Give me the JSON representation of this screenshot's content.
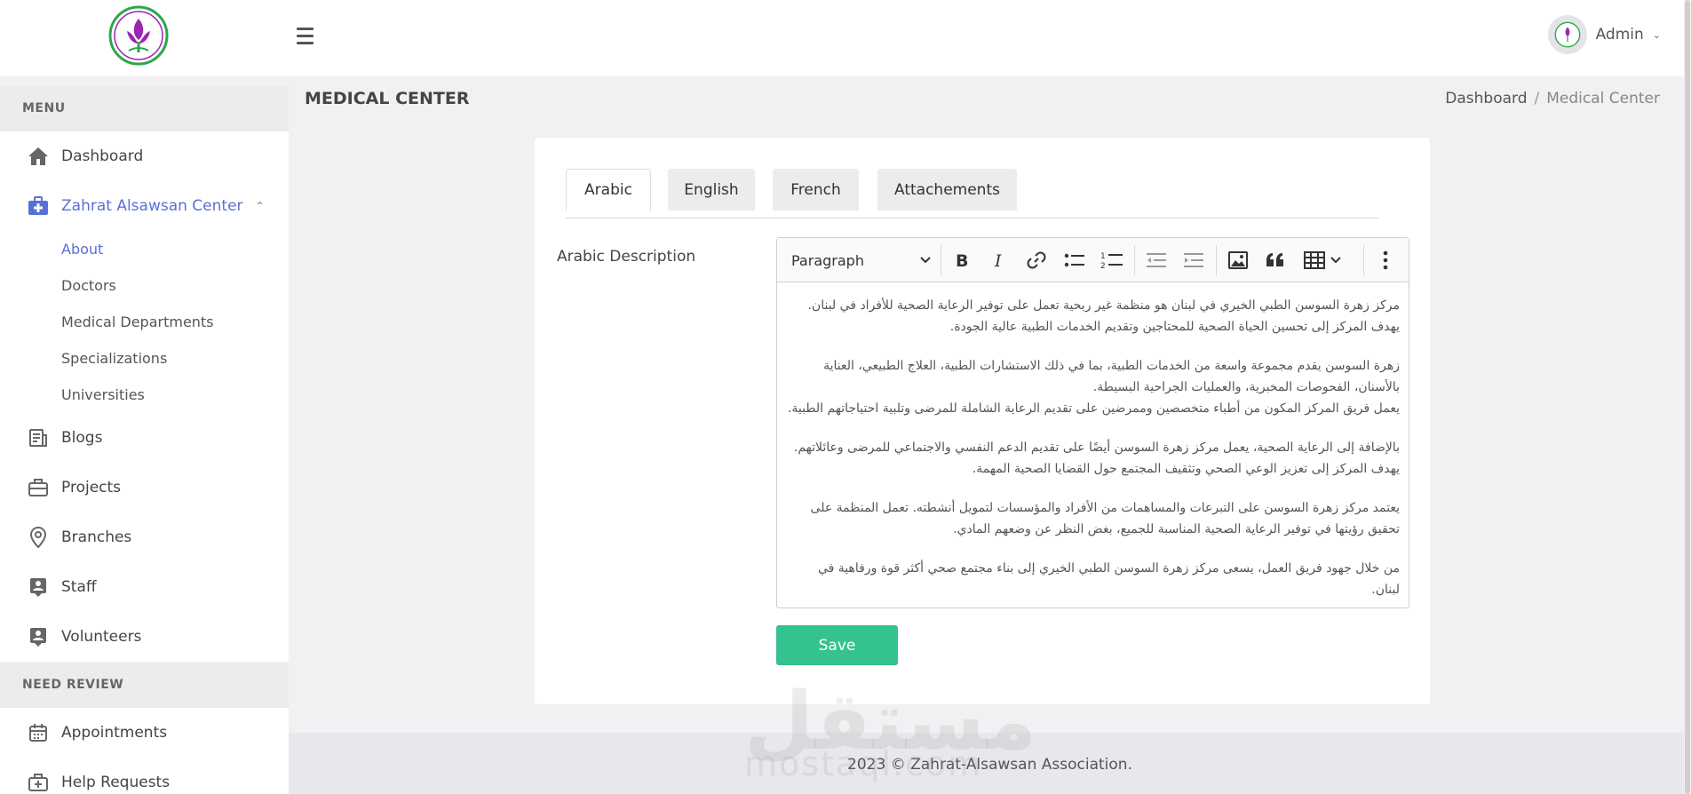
{
  "header": {
    "user_name": "Admin"
  },
  "sidebar": {
    "menu_header": "MENU",
    "items": [
      {
        "label": "Dashboard"
      },
      {
        "label": "Zahrat Alsawsan Center"
      }
    ],
    "sub_items": [
      {
        "label": "About"
      },
      {
        "label": "Doctors"
      },
      {
        "label": "Medical Departments"
      },
      {
        "label": "Specializations"
      },
      {
        "label": "Universities"
      }
    ],
    "items2": [
      {
        "label": "Blogs"
      },
      {
        "label": "Projects"
      },
      {
        "label": "Branches"
      },
      {
        "label": "Staff"
      },
      {
        "label": "Volunteers"
      }
    ],
    "review_header": "NEED REVIEW",
    "review_items": [
      {
        "label": "Appointments"
      },
      {
        "label": "Help Requests"
      }
    ]
  },
  "page": {
    "title": "MEDICAL CENTER",
    "breadcrumb": [
      "Dashboard",
      "/",
      "Medical Center"
    ]
  },
  "tabs": [
    {
      "label": "Arabic"
    },
    {
      "label": "English"
    },
    {
      "label": "French"
    },
    {
      "label": "Attachements"
    }
  ],
  "form": {
    "field_label": "Arabic Description",
    "paragraph_style": "Paragraph",
    "content": [
      "مركز زهرة السوسن الطبي الخيري في لبنان هو منظمة غير ربحية تعمل على توفير الرعاية الصحية للأفراد في لبنان. يهدف المركز إلى تحسين الحياة الصحية للمحتاجين وتقديم الخدمات الطبية عالية الجودة.",
      "زهرة السوسن يقدم مجموعة واسعة من الخدمات الطبية، بما في ذلك الاستشارات الطبية، العلاج الطبيعي، العناية بالأسنان، الفحوصات المخبرية، والعمليات الجراحية البسيطة.",
      "يعمل فريق المركز المكون من أطباء متخصصين وممرضين على تقديم الرعاية الشاملة للمرضى وتلبية احتياجاتهم الطبية.",
      "بالإضافة إلى الرعاية الصحية، يعمل مركز زهرة السوسن أيضًا على تقديم الدعم النفسي والاجتماعي للمرضى وعائلاتهم. يهدف المركز إلى تعزيز الوعي الصحي وتثقيف المجتمع حول القضايا الصحية المهمة.",
      "يعتمد مركز زهرة السوسن على التبرعات والمساهمات من الأفراد والمؤسسات لتمويل أنشطته. تعمل المنظمة على تحقيق رؤيتها في توفير الرعاية الصحية المناسبة للجميع، بغض النظر عن وضعهم المادي.",
      "من خلال جهود فريق العمل، يسعى مركز زهرة السوسن الطبي الخيري إلى بناء مجتمع صحي أكثر قوة ورفاهية في لبنان."
    ],
    "save_label": "Save"
  },
  "footer": {
    "text": "2023 © Zahrat-Alsawsan Association."
  },
  "watermark": {
    "main": "مستقل",
    "sub": "mostaql.com"
  },
  "colors": {
    "accent": "#5a6fd6",
    "save": "#34c28e",
    "logo_green": "#2aa84a",
    "logo_purple": "#9b27b0"
  }
}
